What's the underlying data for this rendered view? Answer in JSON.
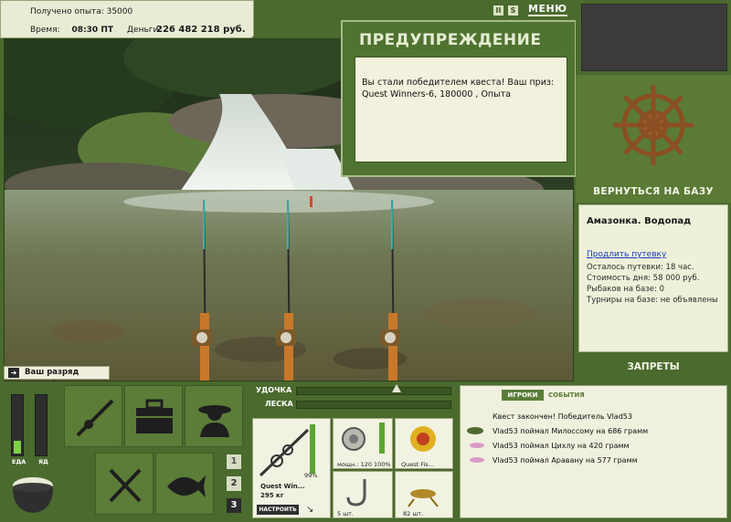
{
  "info": {
    "experience_label": "Получено опыта: 35000",
    "time_label": "Время:",
    "time_value": "08:30 ПТ",
    "money_label": "Деньги:",
    "money_value": "226 482 218 руб."
  },
  "top": {
    "pause_btn": "II",
    "sound_btn": "S",
    "menu_label": "МЕНЮ"
  },
  "warning": {
    "title": "ПРЕДУПРЕЖДЕНИЕ",
    "body": "Вы стали победителем квеста! Ваш приз: Quest Winners-6, 180000 , Опыта"
  },
  "right": {
    "return_label": "ВЕРНУТЬСЯ НА БАЗУ",
    "place_title": "Амазонка. Водопад",
    "extend_link": "Продлить путевку",
    "lines": [
      "Осталось путевки: 18 час.",
      "Стоимость дня: 58 000 руб.",
      "Рыбаков на базе: 0",
      "Турниры на базе: не объявлены"
    ],
    "bans_label": "ЗАПРЕТЫ"
  },
  "rank": {
    "text": "Ваш разряд вырос!"
  },
  "needs": {
    "food_label": "ЕДА",
    "poison_label": "ЯД",
    "food_level": 0.22,
    "poison_level": 0
  },
  "nums": [
    "1",
    "2",
    "3"
  ],
  "tackle": {
    "rod_label": "УДОЧКА",
    "line_label": "ЛЕСКА",
    "rod_percent": "99%",
    "rod_name": "Quest Win...",
    "rod_weight": "295 кг",
    "configure_btn": "НАСТРОИТЬ",
    "reel_label": "мощн.: 120",
    "reel_percent": "100%",
    "line_name": "Quest Fis...",
    "hook_count": "5 шт.",
    "bait_count": "82 шт."
  },
  "log": {
    "tab_players": "ИГРОКИ",
    "tab_events": "СОБЫТИЯ",
    "lines": [
      "Квест закончен! Победитель Vlad53",
      "Vlad53 поймал Милоссому на 686 грамм",
      "Vlad53 поймал Цихлу на 420 грамм",
      "Vlad53 поймал Аравану на 577 грамм"
    ]
  },
  "colors": {
    "panel_green": "#4a6a2e",
    "accent_green": "#7dd145",
    "paper": "#f0f0de"
  }
}
